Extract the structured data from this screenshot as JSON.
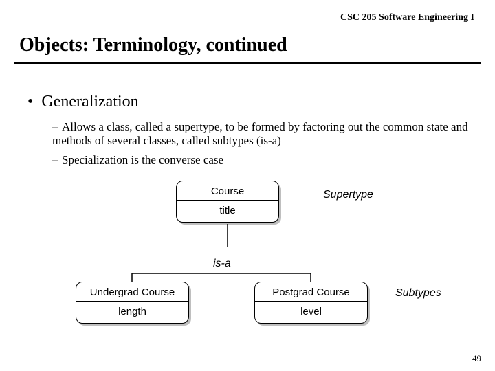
{
  "header": {
    "course": "CSC 205 Software Engineering I"
  },
  "title": "Objects: Terminology, continued",
  "bullets": {
    "b1": "Generalization",
    "s1": "Allows a class, called a supertype, to be formed by factoring out the common state and methods of several classes, called subtypes (is-a)",
    "s2": "Specialization is the converse case"
  },
  "diagram": {
    "supertype": {
      "name": "Course",
      "attr": "title"
    },
    "rel": "is-a",
    "subtypes": [
      {
        "name": "Undergrad Course",
        "attr": "length"
      },
      {
        "name": "Postgrad Course",
        "attr": "level"
      }
    ],
    "labels": {
      "super": "Supertype",
      "sub": "Subtypes"
    }
  },
  "page": "49"
}
